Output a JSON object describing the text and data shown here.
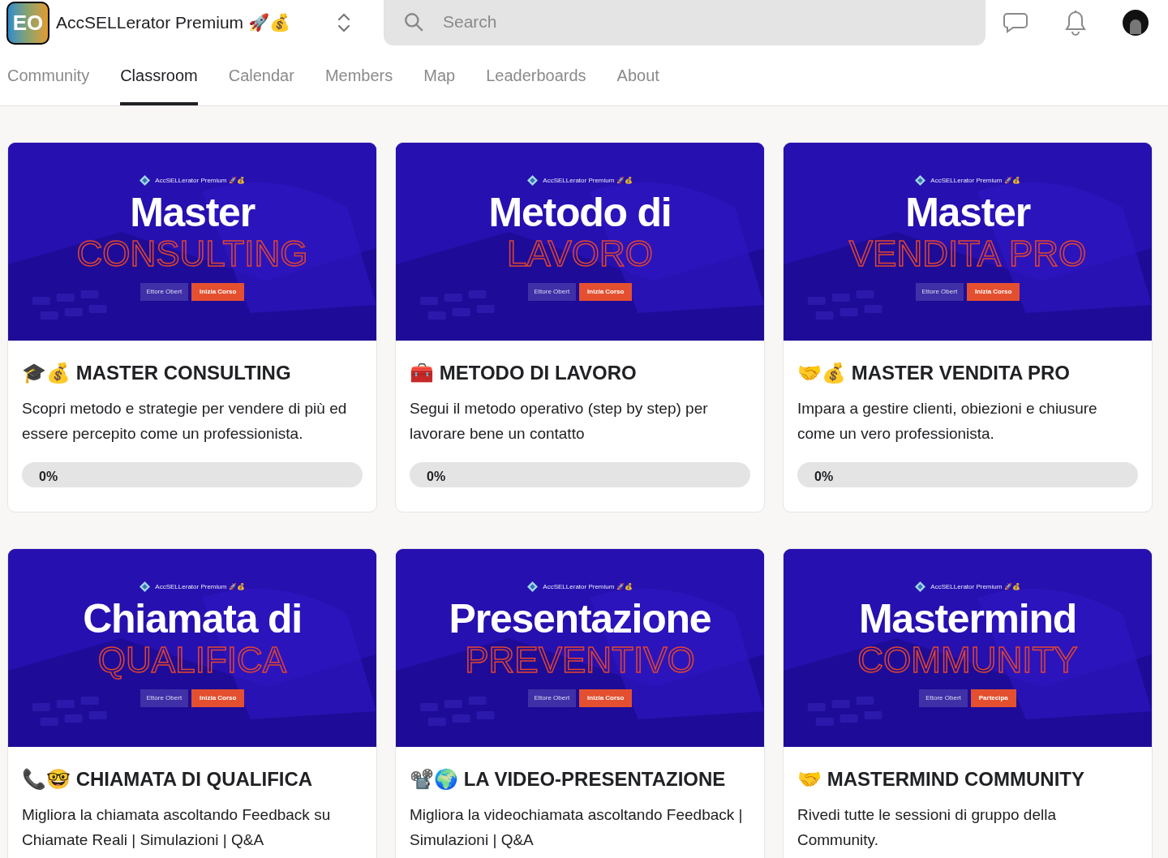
{
  "header": {
    "logo": "EO",
    "group_name": "AccSELLerator Premium 🚀💰",
    "search": {
      "placeholder": "Search"
    }
  },
  "tabs": [
    {
      "label": "Community",
      "selected": false
    },
    {
      "label": "Classroom",
      "selected": true
    },
    {
      "label": "Calendar",
      "selected": false
    },
    {
      "label": "Members",
      "selected": false
    },
    {
      "label": "Map",
      "selected": false
    },
    {
      "label": "Leaderboards",
      "selected": false
    },
    {
      "label": "About",
      "selected": false
    }
  ],
  "courses": [
    {
      "cover": {
        "brand": "AccSELLerator Premium 🚀💰",
        "title": "Master",
        "subtitle": "CONSULTING",
        "author": "Ettore Obert",
        "action": "Inizia Corso"
      },
      "title": "🎓💰 MASTER CONSULTING",
      "description": "Scopri metodo e strategie per vendere di più ed essere percepito come un professionista.",
      "progress": "0%",
      "level": 0
    },
    {
      "cover": {
        "brand": "AccSELLerator Premium 🚀💰",
        "title": "Metodo di",
        "subtitle": "LAVORO",
        "author": "Ettore Obert",
        "action": "Inizia Corso"
      },
      "title": "🧰 METODO DI LAVORO",
      "description": "Segui il metodo operativo (step by step) per lavorare bene un contatto",
      "progress": "0%",
      "level": 0
    },
    {
      "cover": {
        "brand": "AccSELLerator Premium 🚀💰",
        "title": "Master",
        "subtitle": "VENDITA PRO",
        "author": "Ettore Obert",
        "action": "Inizia Corso"
      },
      "title": "🤝💰 MASTER VENDITA PRO",
      "description": "Impara a gestire clienti, obiezioni e chiusure come un vero professionista.",
      "progress": "0%",
      "level": 0
    },
    {
      "cover": {
        "brand": "AccSELLerator Premium 🚀💰",
        "title": "Chiamata di",
        "subtitle": "QUALIFICA",
        "author": "Ettore Obert",
        "action": "Inizia Corso"
      },
      "title": "📞🤓 CHIAMATA DI QUALIFICA",
      "description": "Migliora la chiamata ascoltando Feedback su Chiamate Reali | Simulazioni | Q&A"
    },
    {
      "cover": {
        "brand": "AccSELLerator Premium 🚀💰",
        "title": "Presentazione",
        "subtitle": "PREVENTIVO",
        "author": "Ettore Obert",
        "action": "Inizia Corso"
      },
      "title": "📽️🌍 LA VIDEO-PRESENTAZIONE",
      "description": "Migliora la videochiamata ascoltando Feedback | Simulazioni | Q&A"
    },
    {
      "cover": {
        "brand": "AccSELLerator Premium 🚀💰",
        "title": "Mastermind",
        "subtitle": "COMMUNITY",
        "author": "Ettore Obert",
        "action": "Partecipa"
      },
      "title": "🤝 MASTERMIND COMMUNITY",
      "description": "Rivedi tutte le sessioni di gruppo della Community."
    }
  ]
}
